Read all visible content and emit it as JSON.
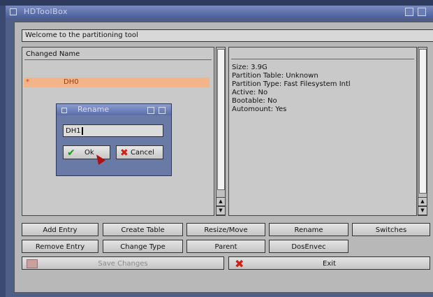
{
  "window": {
    "title": "HDToolBox"
  },
  "welcome_text": "Welcome to the partitioning tool",
  "list": {
    "header": "Changed Name",
    "rows": [
      {
        "marker": "*",
        "name": "DH0"
      }
    ]
  },
  "info": {
    "lines": [
      "Size: 3.9G",
      "Partition Table: Unknown",
      "Partition Type: Fast Filesystem Intl",
      "Active: No",
      "Bootable: No",
      "Automount: Yes"
    ]
  },
  "buttons": {
    "add_entry": "Add Entry",
    "create_table": "Create Table",
    "resize_move": "Resize/Move",
    "rename": "Rename",
    "switches": "Switches",
    "remove_entry": "Remove Entry",
    "change_type": "Change Type",
    "parent": "Parent",
    "dosenvec": "DosEnvec",
    "save_changes": "Save Changes",
    "exit": "Exit"
  },
  "rename_dialog": {
    "title": "Rename",
    "input_value": "DH1",
    "ok_label": "Ok",
    "cancel_label": "Cancel"
  }
}
